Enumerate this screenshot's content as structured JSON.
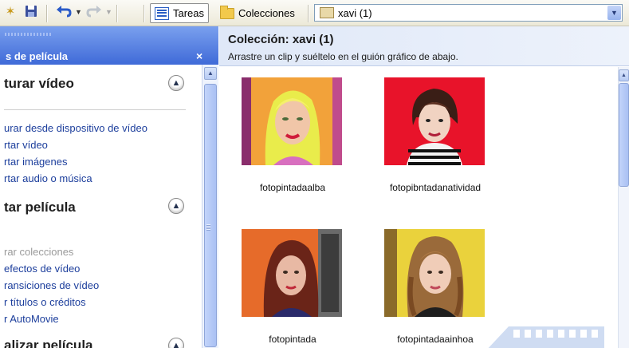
{
  "toolbar": {
    "tasks_label": "Tareas",
    "collections_label": "Colecciones",
    "collection_combo_value": "xavi (1)"
  },
  "taskpane": {
    "header_title": "s de película",
    "close_glyph": "×",
    "sections": [
      {
        "title": "turar vídeo",
        "links": [
          {
            "label": "urar desde dispositivo de vídeo",
            "enabled": true
          },
          {
            "label": "rtar vídeo",
            "enabled": true
          },
          {
            "label": "rtar imágenes",
            "enabled": true
          },
          {
            "label": "rtar audio o música",
            "enabled": true
          }
        ]
      },
      {
        "title": "tar película",
        "links": [
          {
            "label": "rar colecciones",
            "enabled": false
          },
          {
            "label": "efectos de vídeo",
            "enabled": true
          },
          {
            "label": "ransiciones de vídeo",
            "enabled": true
          },
          {
            "label": "r títulos o créditos",
            "enabled": true
          },
          {
            "label": "r AutoMovie",
            "enabled": true
          }
        ]
      },
      {
        "title": "alizar película",
        "links": []
      }
    ]
  },
  "collection": {
    "title": "Colección: xavi (1)",
    "instructions": "Arrastre un clip y suéltelo en el guión gráfico de abajo."
  },
  "clips": [
    {
      "name": "fotopintadaalba"
    },
    {
      "name": "fotopibntadanatividad"
    },
    {
      "name": "fotopintada"
    },
    {
      "name": "fotopintadaainhoa"
    }
  ],
  "icons": {
    "toolbar": [
      "refresh-icon",
      "save-icon",
      "undo-icon",
      "redo-icon",
      "tasks-icon",
      "collections-folder-icon",
      "collection-icon"
    ],
    "collapse": "chevron-up-icon"
  },
  "colors": {
    "taskpane_blue": "#6b8cdf",
    "link_blue": "#1c3e9c",
    "header_bg": "#dfe8f8"
  }
}
